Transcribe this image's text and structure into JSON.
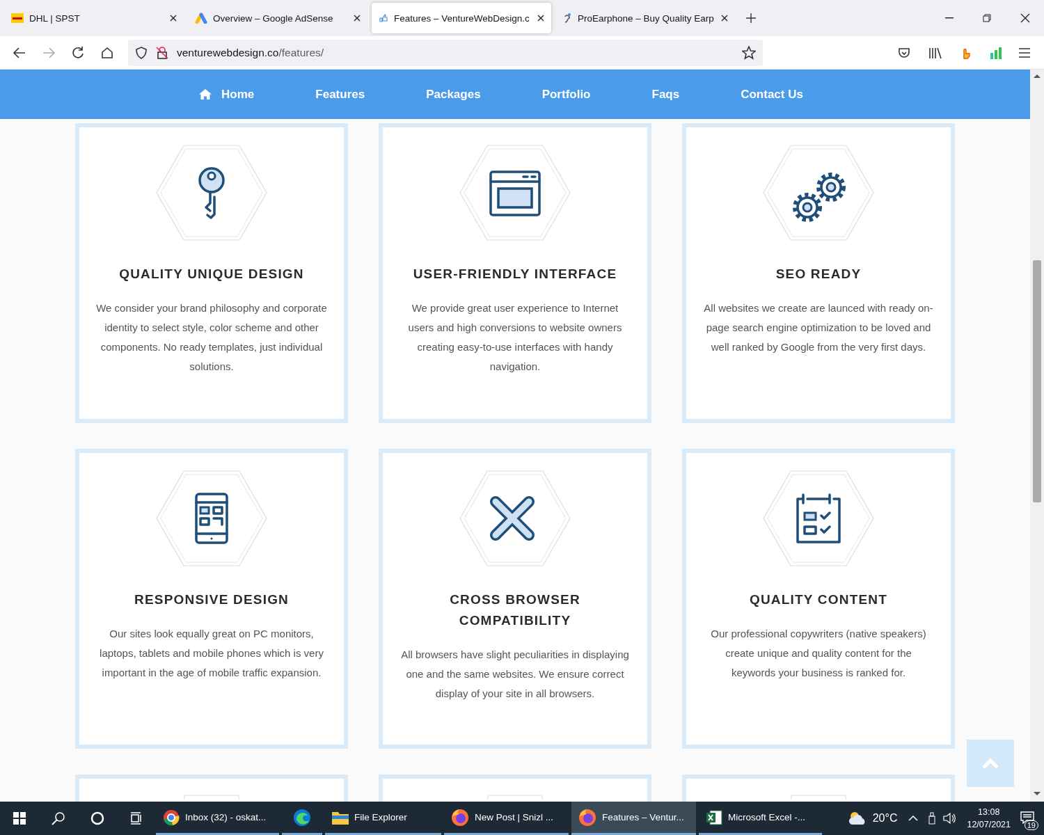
{
  "browser_tabs": [
    {
      "title": "DHL | SPST",
      "kind": "dhl",
      "selected": false
    },
    {
      "title": "Overview – Google AdSense",
      "kind": "adsense",
      "selected": false
    },
    {
      "title": "Features – VentureWebDesign.c",
      "kind": "page",
      "selected": true
    },
    {
      "title": "ProEarphone – Buy Quality Earp",
      "kind": "earphone",
      "selected": false
    }
  ],
  "address_bar": {
    "host": "venturewebdesign.co",
    "path": "/features/"
  },
  "nav": [
    {
      "label": "Home",
      "kind": "home"
    },
    {
      "label": "Features",
      "kind": "plain"
    },
    {
      "label": "Packages",
      "kind": "plain"
    },
    {
      "label": "Portfolio",
      "kind": "plain"
    },
    {
      "label": "Faqs",
      "kind": "plain"
    },
    {
      "label": "Contact Us",
      "kind": "plain"
    }
  ],
  "features": [
    {
      "kind": "key",
      "title": "QUALITY UNIQUE DESIGN",
      "text": "We consider your brand philosophy and corporate identity to select style, color scheme and other components. No ready templates, just individual solutions."
    },
    {
      "kind": "browser",
      "title": "USER-FRIENDLY INTERFACE",
      "text": "We provide great user experience to Internet users and high conversions to website owners creating easy-to-use interfaces with handy navigation."
    },
    {
      "kind": "gears",
      "title": "SEO READY",
      "text": "All websites we create are launced with ready on-page search engine optimization to be loved and well ranked by Google from the very first days."
    },
    {
      "kind": "phone",
      "title": "RESPONSIVE DESIGN",
      "text": "Our sites look equally great on PC monitors, laptops, tablets and mobile phones which is very important in the age of mobile traffic expansion."
    },
    {
      "kind": "cross",
      "title": "CROSS BROWSER COMPATIBILITY",
      "text": "All browsers have slight peculiarities in displaying one and the same websites. We ensure correct display of your site in all browsers."
    },
    {
      "kind": "checklist",
      "title": "QUALITY CONTENT",
      "text": "Our professional copywriters (native speakers) create unique and quality content for the keywords your business is ranked for."
    }
  ],
  "taskbar": {
    "apps": [
      {
        "label": "Inbox (32) - oskat...",
        "kind": "chrome",
        "selected": false
      },
      {
        "kind": "edge",
        "selected": false
      },
      {
        "label": "File Explorer",
        "kind": "folder",
        "selected": false
      },
      {
        "label": "New Post | Snizl ...",
        "kind": "firefox",
        "selected": false
      },
      {
        "label": "Features – Ventur...",
        "kind": "firefox",
        "selected": true
      },
      {
        "label": "Microsoft Excel -...",
        "kind": "excel",
        "selected": false
      }
    ],
    "temperature": "20°C",
    "time": "13:08",
    "date": "12/07/2021",
    "notifications": "19"
  }
}
